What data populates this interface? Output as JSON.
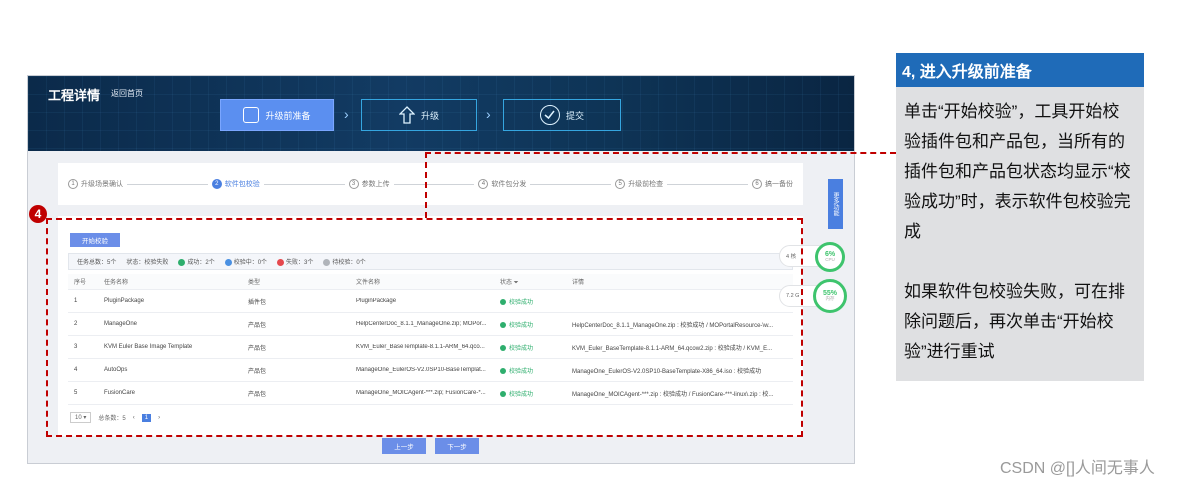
{
  "header": {
    "title": "工程详情",
    "back_link": "返回首页"
  },
  "stages": [
    {
      "label": "升级前准备",
      "icon": "checklist-icon"
    },
    {
      "label": "升级",
      "icon": "upload-arrow-icon"
    },
    {
      "label": "提交",
      "icon": "check-circle-icon"
    }
  ],
  "steps": [
    {
      "num": "1",
      "label": "升级场景确认"
    },
    {
      "num": "2",
      "label": "软件包校验"
    },
    {
      "num": "3",
      "label": "参数上传"
    },
    {
      "num": "4",
      "label": "软件包分发"
    },
    {
      "num": "5",
      "label": "升级前检查"
    },
    {
      "num": "6",
      "label": "搞一备份"
    }
  ],
  "toolbar": {
    "start_label": "开始校验"
  },
  "summary": {
    "total": "任务总数：5个",
    "state": "状态：校验失败",
    "success": "成功：2个",
    "verifying": "校验中：0个",
    "failed": "失败：3个",
    "pending": "待校验：0个"
  },
  "table": {
    "headers": {
      "idx": "序号",
      "name": "任务名称",
      "type": "类型",
      "file": "文件名称",
      "status": "状态",
      "detail": "详情"
    },
    "rows": [
      {
        "idx": "1",
        "name": "PluginPackage",
        "type": "插件包",
        "file": "PluginPackage",
        "status": "校验成功",
        "detail": ""
      },
      {
        "idx": "2",
        "name": "ManageOne",
        "type": "产品包",
        "file": "HelpCenterDoc_8.1.1_ManageOne.zip; MOPor...",
        "status": "校验成功",
        "detail": "HelpCenterDoc_8.1.1_ManageOne.zip : 校验成功 / MOPortalResource-\\w..."
      },
      {
        "idx": "3",
        "name": "KVM Euler Base Image Template",
        "type": "产品包",
        "file": "KVM_Euler_BaseTemplate-8.1.1-ARM_64.qco...",
        "status": "校验成功",
        "detail": "KVM_Euler_BaseTemplate-8.1.1-ARM_64.qcow2.zip : 校验成功 / KVM_E..."
      },
      {
        "idx": "4",
        "name": "AutoOps",
        "type": "产品包",
        "file": "ManageOne_EulerOS-V2.0SP10-BaseTemplat...",
        "status": "校验成功",
        "detail": "ManageOne_EulerOS-V2.0SP10-BaseTemplate-X86_64.iso : 校验成功"
      },
      {
        "idx": "5",
        "name": "FusionCare",
        "type": "产品包",
        "file": "ManageOne_MOICAgent-***.zip; FusionCare-*...",
        "status": "校验成功",
        "detail": "ManageOne_MOICAgent-***.zip : 校验成功 / FusionCare-***-linux\\.zip : 校..."
      }
    ]
  },
  "pager": {
    "size": "10",
    "total": "总条数：5",
    "page": "1"
  },
  "nav": {
    "prev": "上一步",
    "next": "下一步"
  },
  "side": {
    "more_label": "更多功能",
    "cpu_pct": "6%",
    "cpu_label": "CPU",
    "mem_pct": "55%",
    "mem_label": "内存",
    "chip1": "4 核",
    "chip2": "7.2 G"
  },
  "marker": "4",
  "callout": {
    "title": "4, 进入升级前准备",
    "para1": "单击“开始校验”，工具开始校验插件包和产品包，当所有的插件包和产品包状态均显示“校验成功”时，表示软件包校验完成",
    "para2": "如果软件包校验失败，可在排除问题后，再次单击“开始校验”进行重试"
  },
  "watermark": "CSDN @[]人间无事人",
  "colors": {
    "accent": "#4a7fe0",
    "success": "#2eae6d",
    "highlight": "#c00000",
    "callout_head": "#1f6bb8"
  }
}
